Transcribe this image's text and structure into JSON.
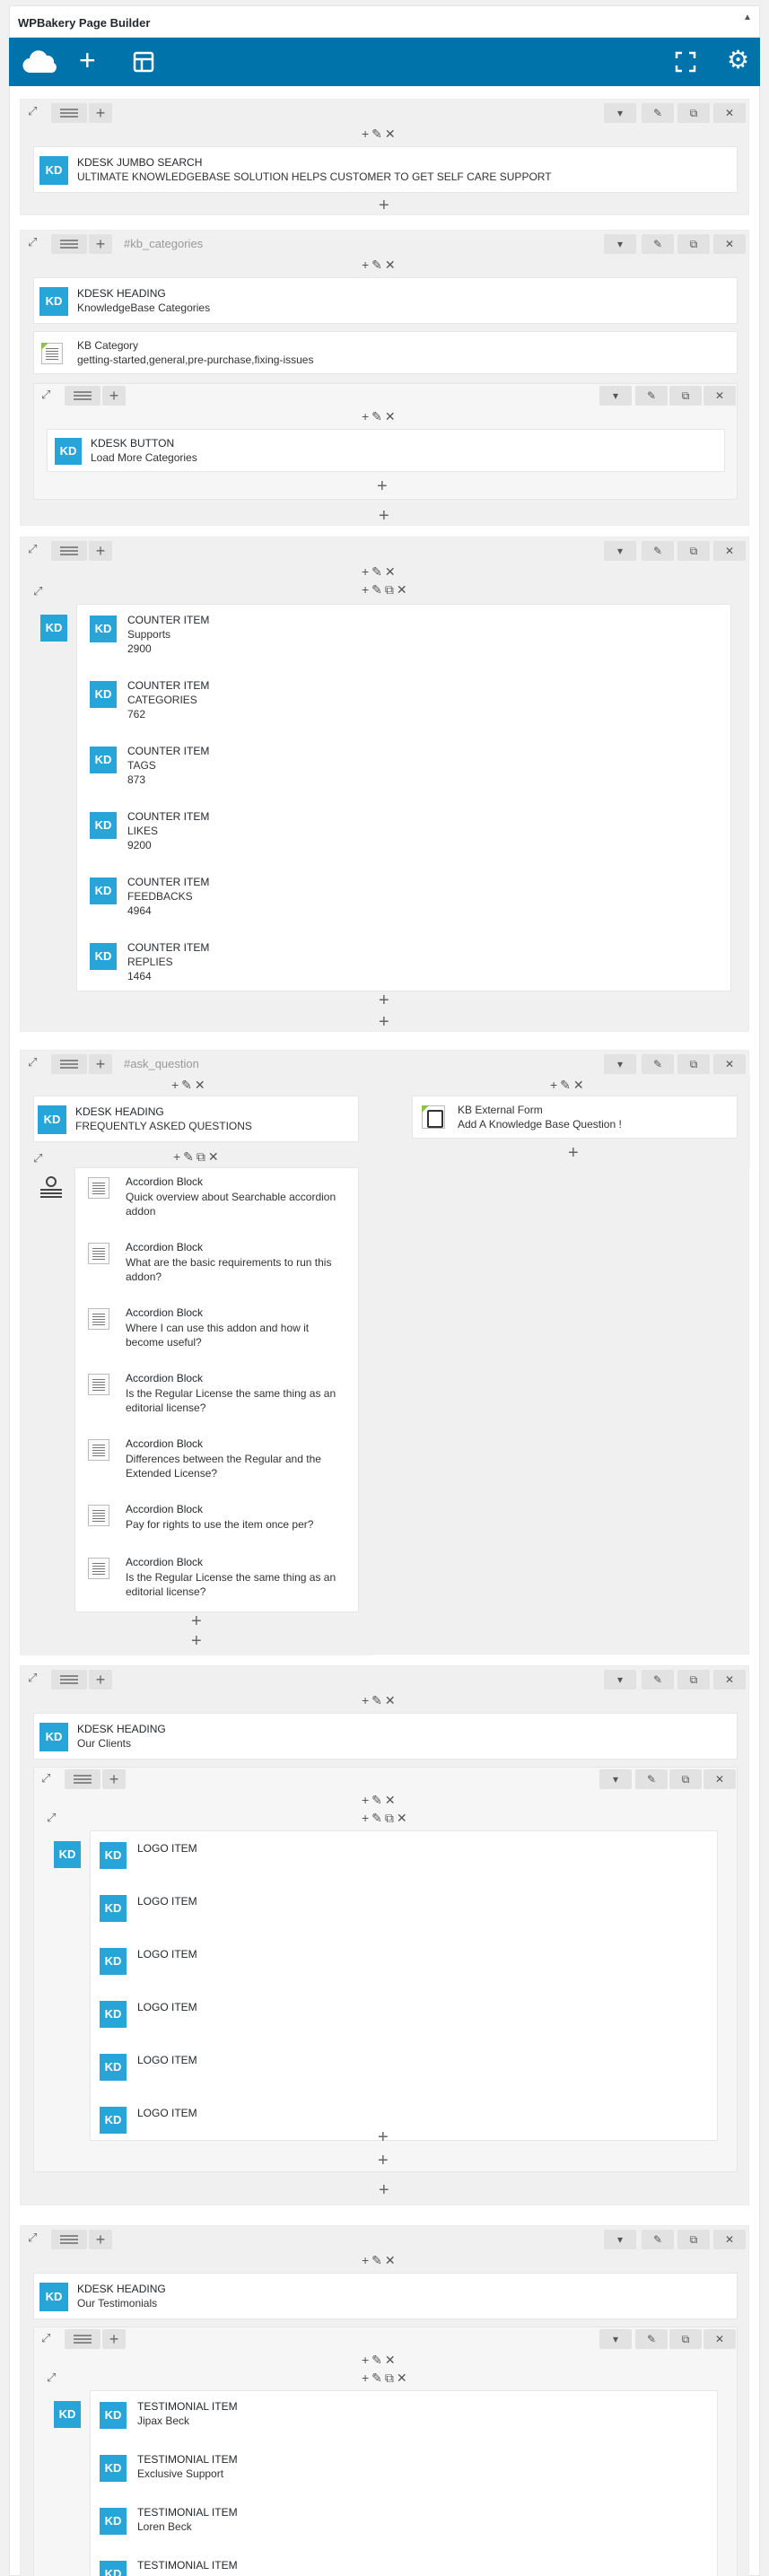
{
  "header": {
    "title": "WPBakery Page Builder",
    "collapse_icon": "caret-up-icon"
  },
  "navbar": {
    "icons": [
      "cloud-templates-icon",
      "add-element-icon",
      "layout-templates-icon",
      "fullscreen-icon",
      "settings-gear-icon"
    ]
  },
  "controls": {
    "add": "+",
    "edit": "✎",
    "clone": "⧉",
    "delete": "✕",
    "toggle": "▾"
  },
  "rows": {
    "r1": {
      "kdesk": "KD",
      "el1": {
        "title": "KDESK JUMBO SEARCH",
        "sub": "ULTIMATE KNOWLEDGEBASE SOLUTION HELPS CUSTOMER TO GET SELF CARE SUPPORT"
      }
    },
    "r2": {
      "anchor": "#kb_categories",
      "el1": {
        "title": "KDESK HEADING",
        "sub": "KnowledgeBase Categories"
      },
      "el2": {
        "title": "KB Category",
        "sub": "getting-started,general,pre-purchase,fixing-issues"
      },
      "el3": {
        "title": "KDESK BUTTON",
        "sub": "Load More Categories"
      }
    },
    "r3": {
      "counters": [
        {
          "title": "COUNTER ITEM",
          "label": "Supports",
          "value": "2900"
        },
        {
          "title": "COUNTER ITEM",
          "label": "CATEGORIES",
          "value": "762"
        },
        {
          "title": "COUNTER ITEM",
          "label": "TAGS",
          "value": "873"
        },
        {
          "title": "COUNTER ITEM",
          "label": "LIKES",
          "value": "9200"
        },
        {
          "title": "COUNTER ITEM",
          "label": "FEEDBACKS",
          "value": "4964"
        },
        {
          "title": "COUNTER ITEM",
          "label": "REPLIES",
          "value": "1464"
        }
      ]
    },
    "r4": {
      "anchor": "#ask_question",
      "heading": {
        "title": "KDESK HEADING",
        "sub": "FREQUENTLY ASKED QUESTIONS"
      },
      "accordions": [
        {
          "title": "Accordion Block",
          "sub": "Quick overview about Searchable accordion addon"
        },
        {
          "title": "Accordion Block",
          "sub": "What are the basic requirements to run this addon?"
        },
        {
          "title": "Accordion Block",
          "sub": "Where I can use this addon and how it become useful?"
        },
        {
          "title": "Accordion Block",
          "sub": "Is the Regular License the same thing as an editorial license?"
        },
        {
          "title": "Accordion Block",
          "sub": "Differences between the Regular and the Extended License?"
        },
        {
          "title": "Accordion Block",
          "sub": "Pay for rights to use the item once per?"
        },
        {
          "title": "Accordion Block",
          "sub": "Is the Regular License the same thing as an editorial license?"
        }
      ],
      "form": {
        "title": "KB External Form",
        "sub": "Add A Knowledge Base Question !"
      }
    },
    "r5": {
      "heading": {
        "title": "KDESK HEADING",
        "sub": "Our Clients"
      },
      "logos": [
        "LOGO ITEM",
        "LOGO ITEM",
        "LOGO ITEM",
        "LOGO ITEM",
        "LOGO ITEM",
        "LOGO ITEM"
      ]
    },
    "r6": {
      "heading": {
        "title": "KDESK HEADING",
        "sub": "Our Testimonials"
      },
      "testimonials": [
        {
          "title": "TESTIMONIAL ITEM",
          "sub": "Jipax Beck"
        },
        {
          "title": "TESTIMONIAL ITEM",
          "sub": "Exclusive Support"
        },
        {
          "title": "TESTIMONIAL ITEM",
          "sub": "Loren Beck"
        },
        {
          "title": "TESTIMONIAL ITEM",
          "sub": ""
        }
      ]
    }
  }
}
